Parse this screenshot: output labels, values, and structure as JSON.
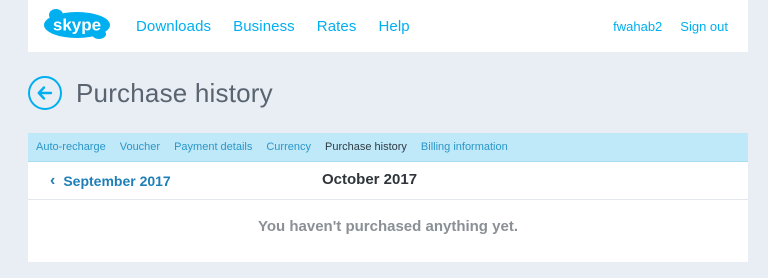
{
  "header": {
    "logo_text": "skype",
    "nav": [
      "Downloads",
      "Business",
      "Rates",
      "Help"
    ],
    "username": "fwahab2",
    "sign_out": "Sign out"
  },
  "page": {
    "title": "Purchase history"
  },
  "tabs": [
    {
      "label": "Auto-recharge",
      "active": false
    },
    {
      "label": "Voucher",
      "active": false
    },
    {
      "label": "Payment details",
      "active": false
    },
    {
      "label": "Currency",
      "active": false
    },
    {
      "label": "Purchase history",
      "active": true
    },
    {
      "label": "Billing information",
      "active": false
    }
  ],
  "history": {
    "previous_month": "September 2017",
    "current_month": "October 2017",
    "empty_message": "You haven't purchased anything yet."
  },
  "colors": {
    "accent": "#00aff0",
    "tab_bar": "#bfe8f8",
    "background": "#e9eef4"
  },
  "icons": {
    "back": "back-arrow-icon",
    "previous": "chevron-left-icon"
  }
}
